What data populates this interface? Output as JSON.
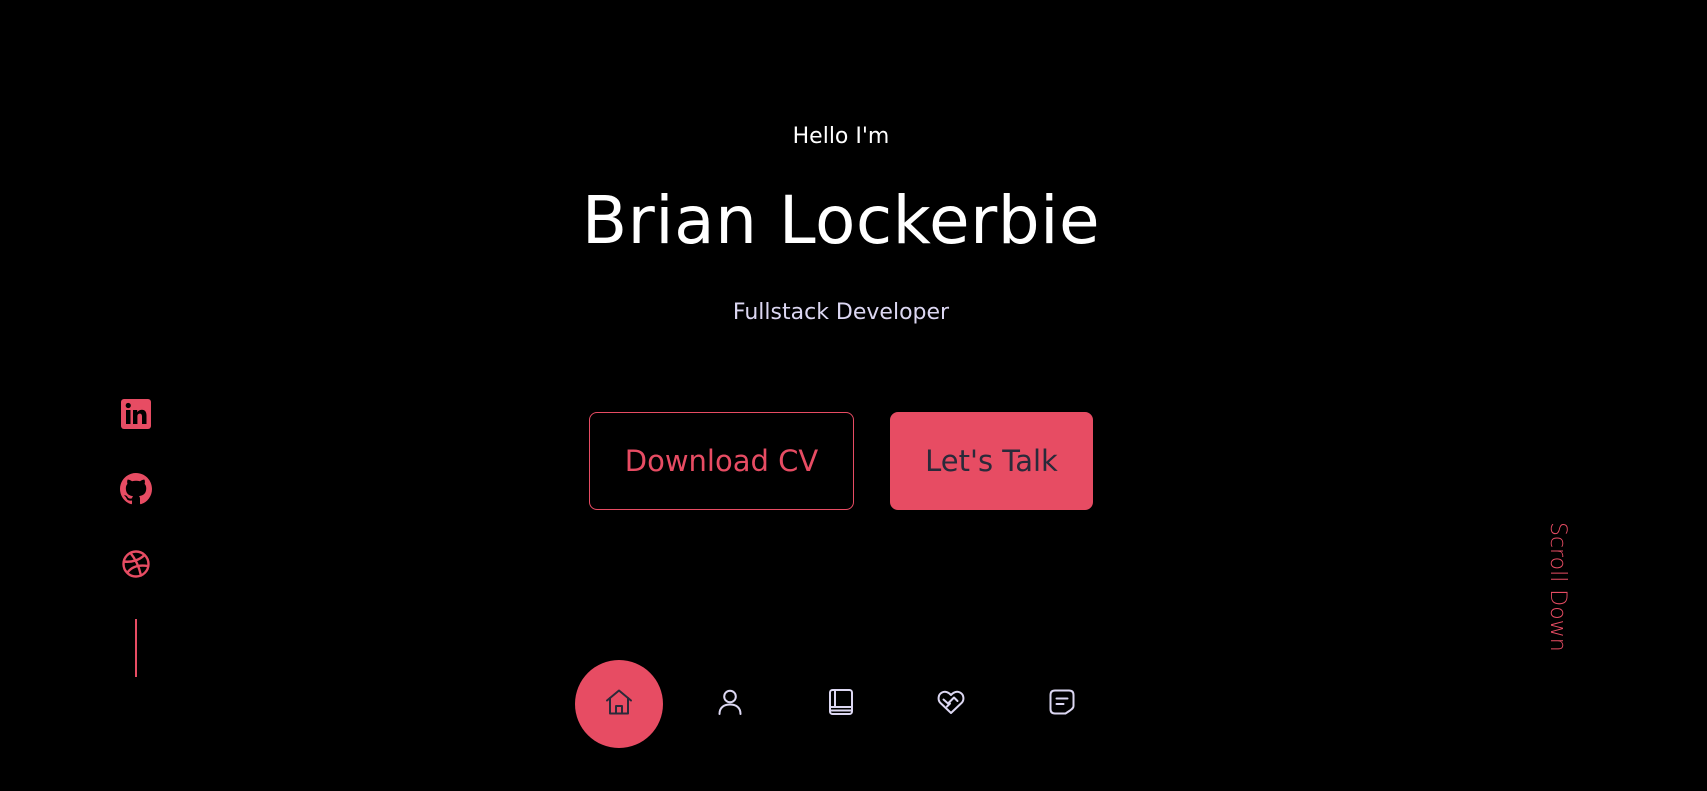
{
  "hero": {
    "greeting": "Hello I'm",
    "name": "Brian Lockerbie",
    "role": "Fullstack Developer"
  },
  "buttons": {
    "download_cv": "Download CV",
    "lets_talk": "Let's Talk"
  },
  "social": [
    {
      "icon": "linkedin-icon"
    },
    {
      "icon": "github-icon"
    },
    {
      "icon": "dribbble-icon"
    }
  ],
  "scroll": {
    "label": "Scroll Down"
  },
  "nav": {
    "items": [
      {
        "icon": "home-icon",
        "active": true
      },
      {
        "icon": "user-icon",
        "active": false
      },
      {
        "icon": "book-icon",
        "active": false
      },
      {
        "icon": "services-icon",
        "active": false
      },
      {
        "icon": "message-icon",
        "active": false
      }
    ]
  },
  "colors": {
    "background": "#000000",
    "accent": "#e74c63",
    "text": "#ffffff",
    "muted_text": "#dcd7f2",
    "nav_icon": "#dcd7f2",
    "active_nav_icon": "#2a2a3a"
  }
}
